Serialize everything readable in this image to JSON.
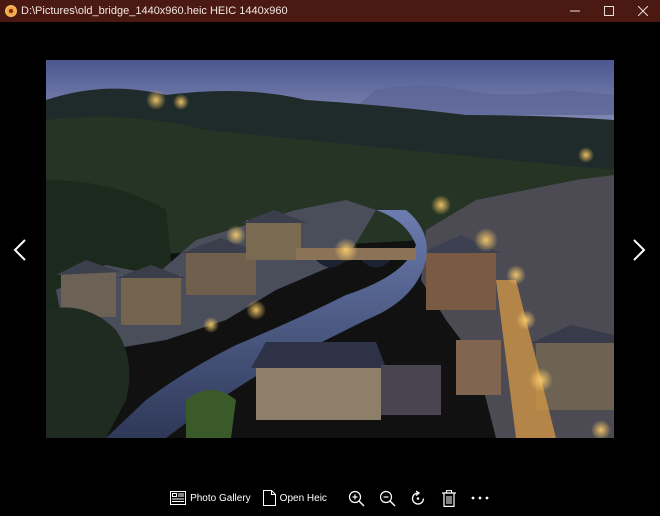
{
  "window": {
    "title": "D:\\Pictures\\old_bridge_1440x960.heic HEIC 1440x960",
    "app_icon": "viewer-app-icon",
    "controls": [
      "minimize-icon",
      "maximize-icon",
      "close-icon"
    ]
  },
  "viewer": {
    "prev_icon": "chevron-left-icon",
    "next_icon": "chevron-right-icon"
  },
  "toolbar": {
    "photo_gallery_label": "Photo Gallery",
    "open_heic_label": "Open Heic",
    "icons": [
      "gallery-icon",
      "file-icon",
      "zoom-in-icon",
      "zoom-out-icon",
      "rotate-icon",
      "delete-icon",
      "more-icon"
    ]
  },
  "colors": {
    "titlebar": "#4a1a12",
    "background": "#000000"
  }
}
